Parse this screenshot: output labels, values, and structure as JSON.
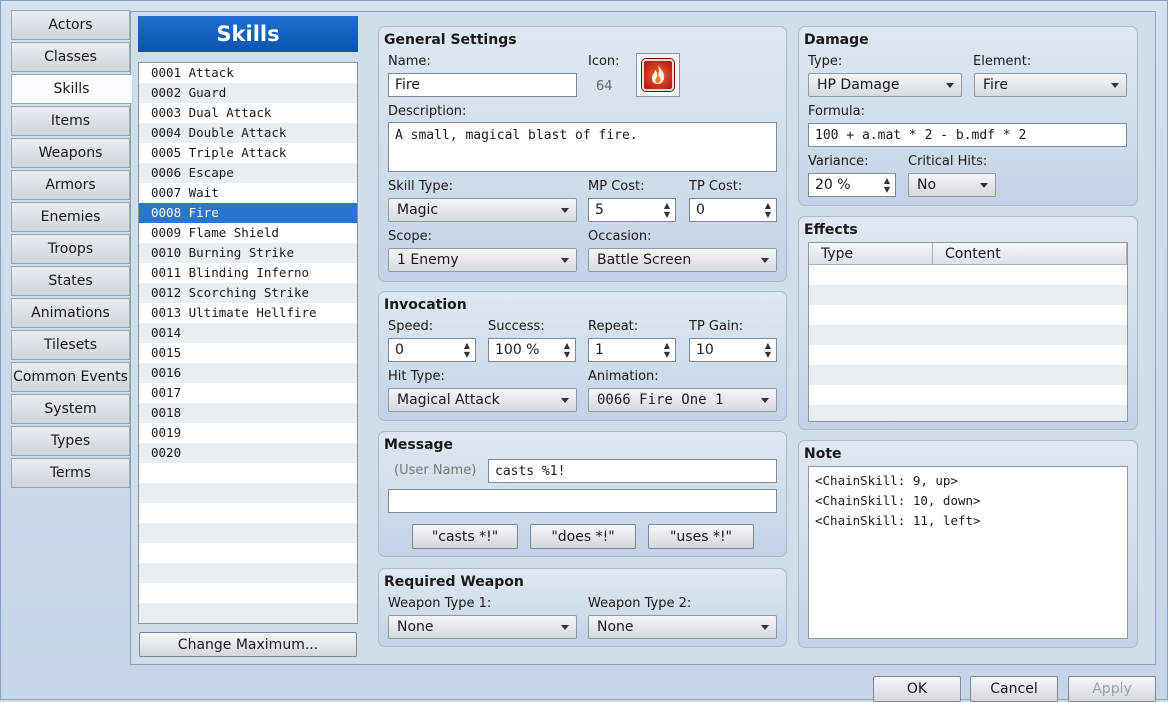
{
  "tabs": [
    "Actors",
    "Classes",
    "Skills",
    "Items",
    "Weapons",
    "Armors",
    "Enemies",
    "Troops",
    "States",
    "Animations",
    "Tilesets",
    "Common Events",
    "System",
    "Types",
    "Terms"
  ],
  "active_tab": "Skills",
  "list": {
    "title": "Skills",
    "items": [
      "0001 Attack",
      "0002 Guard",
      "0003 Dual Attack",
      "0004 Double Attack",
      "0005 Triple Attack",
      "0006 Escape",
      "0007 Wait",
      "0008 Fire",
      "0009 Flame Shield",
      "0010 Burning Strike",
      "0011 Blinding Inferno",
      "0012 Scorching Strike",
      "0013 Ultimate Hellfire",
      "0014",
      "0015",
      "0016",
      "0017",
      "0018",
      "0019",
      "0020"
    ],
    "selected_index": 7,
    "change_max_label": "Change Maximum..."
  },
  "general": {
    "title": "General Settings",
    "name_label": "Name:",
    "name_value": "Fire",
    "icon_label": "Icon:",
    "icon_index": "64",
    "icon_name": "fire-icon",
    "description_label": "Description:",
    "description_value": "A small, magical blast of fire.",
    "skill_type_label": "Skill Type:",
    "skill_type_value": "Magic",
    "mp_cost_label": "MP Cost:",
    "mp_cost_value": "5",
    "tp_cost_label": "TP Cost:",
    "tp_cost_value": "0",
    "scope_label": "Scope:",
    "scope_value": "1 Enemy",
    "occasion_label": "Occasion:",
    "occasion_value": "Battle Screen"
  },
  "invocation": {
    "title": "Invocation",
    "speed_label": "Speed:",
    "speed_value": "0",
    "success_label": "Success:",
    "success_value": "100 %",
    "repeat_label": "Repeat:",
    "repeat_value": "1",
    "tp_gain_label": "TP Gain:",
    "tp_gain_value": "10",
    "hit_type_label": "Hit Type:",
    "hit_type_value": "Magical Attack",
    "animation_label": "Animation:",
    "animation_value": "0066 Fire One 1"
  },
  "message": {
    "title": "Message",
    "user_name": "(User Name)",
    "line1": "casts %1!",
    "line2": "",
    "buttons": [
      "\"casts *!\"",
      "\"does *!\"",
      "\"uses *!\""
    ]
  },
  "required_weapon": {
    "title": "Required Weapon",
    "type1_label": "Weapon Type 1:",
    "type1_value": "None",
    "type2_label": "Weapon Type 2:",
    "type2_value": "None"
  },
  "damage": {
    "title": "Damage",
    "type_label": "Type:",
    "type_value": "HP Damage",
    "element_label": "Element:",
    "element_value": "Fire",
    "formula_label": "Formula:",
    "formula_value": "100 + a.mat * 2 - b.mdf * 2",
    "variance_label": "Variance:",
    "variance_value": "20 %",
    "critical_label": "Critical Hits:",
    "critical_value": "No"
  },
  "effects": {
    "title": "Effects",
    "columns": [
      "Type",
      "Content"
    ]
  },
  "note": {
    "title": "Note",
    "lines": [
      "<ChainSkill: 9, up>",
      "<ChainSkill: 10, down>",
      "<ChainSkill: 11, left>"
    ]
  },
  "dialog_buttons": {
    "ok": "OK",
    "cancel": "Cancel",
    "apply": "Apply"
  }
}
